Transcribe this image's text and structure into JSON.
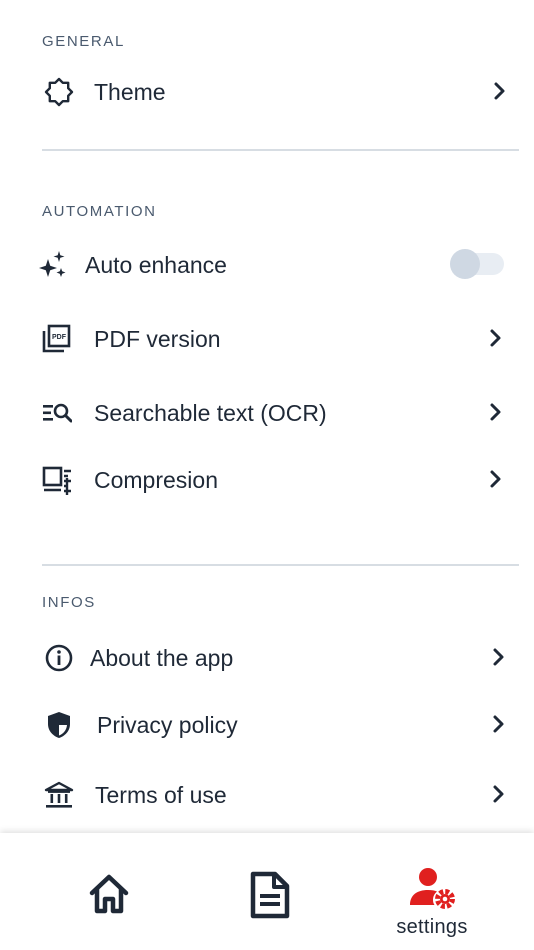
{
  "general": {
    "section_label": "GENERAL",
    "theme_label": "Theme"
  },
  "automation": {
    "section_label": "AUTOMATION",
    "auto_enhance_label": "Auto enhance",
    "auto_enhance_enabled": false,
    "pdf_version_label": "PDF version",
    "ocr_label": "Searchable text (OCR)",
    "compression_label": "Compresion"
  },
  "infos": {
    "section_label": "INFOS",
    "about_label": "About the app",
    "privacy_label": "Privacy policy",
    "terms_label": "Terms of use"
  },
  "bottom_nav": {
    "items": [
      {
        "icon": "home-icon",
        "label": "",
        "active": false
      },
      {
        "icon": "document-icon",
        "label": "",
        "active": false
      },
      {
        "icon": "user-settings-icon",
        "label": "settings",
        "active": true
      }
    ]
  },
  "colors": {
    "accent": "#e0201f",
    "text": "#1f2937",
    "section_label": "#4a5a6e",
    "divider": "#d7dde3"
  }
}
